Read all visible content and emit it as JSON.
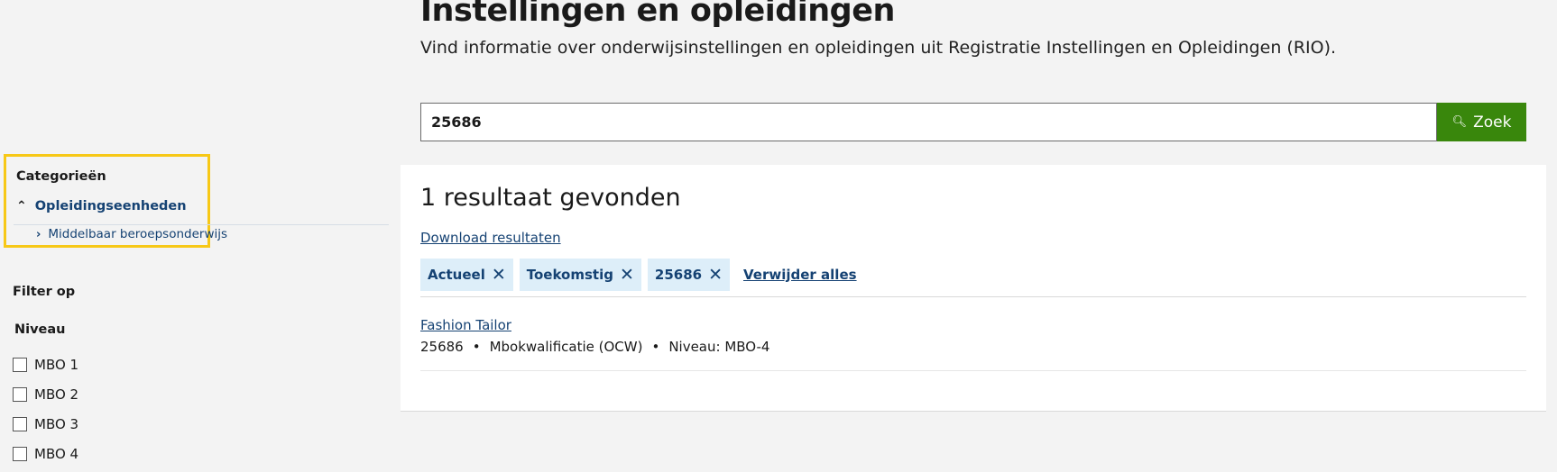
{
  "header": {
    "title": "Instellingen en opleidingen",
    "subtitle": "Vind informatie over onderwijsinstellingen en opleidingen uit Registratie Instellingen en Opleidingen (RIO)."
  },
  "search": {
    "value": "25686",
    "button_label": "Zoek",
    "button_icon": "search-icon"
  },
  "sidebar": {
    "categories_heading": "Categorieën",
    "category": {
      "label": "Opleidingseenheden",
      "icon": "chevron-up-icon"
    },
    "subcategory": {
      "label": "Middelbaar beroepsonderwijs",
      "icon": "chevron-right-icon"
    },
    "filter_heading": "Filter op",
    "niveau_heading": "Niveau",
    "niveau_options": [
      {
        "label": "MBO 1",
        "checked": false
      },
      {
        "label": "MBO 2",
        "checked": false
      },
      {
        "label": "MBO 3",
        "checked": false
      },
      {
        "label": "MBO 4",
        "checked": false
      }
    ]
  },
  "results": {
    "count_text": "1 resultaat gevonden",
    "download_label": "Download resultaten",
    "active_filters": [
      "Actueel",
      "Toekomstig",
      "25686"
    ],
    "remove_all_label": "Verwijder alles",
    "items": [
      {
        "title": "Fashion Tailor",
        "code": "25686",
        "type": "Mbokwalificatie (OCW)",
        "level": "Niveau: MBO-4"
      }
    ]
  },
  "colors": {
    "background": "#f3f3f3",
    "accent_green": "#39870c",
    "link_blue": "#154273",
    "chip_bg": "#ddeef9",
    "highlight_yellow": "#f7c816"
  }
}
